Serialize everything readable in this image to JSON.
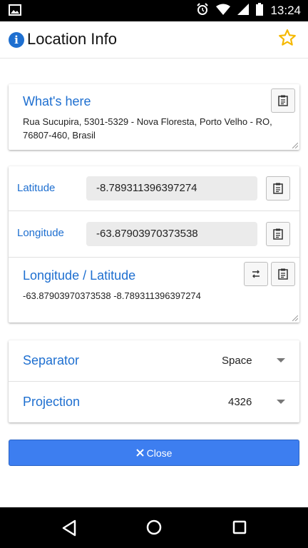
{
  "status_bar": {
    "time": "13:24"
  },
  "app_bar": {
    "title": "Location Info"
  },
  "what_here": {
    "label": "What's here",
    "address": "Rua Sucupira, 5301-5329 - Nova Floresta, Porto Velho - RO, 76807-460, Brasil"
  },
  "coords": {
    "latitude_label": "Latitude",
    "latitude_value": "-8.789311396397274",
    "longitude_label": "Longitude",
    "longitude_value": "-63.87903970373538",
    "lonlat_label": "Longitude / Latitude",
    "lonlat_value": "-63.87903970373538 -8.789311396397274"
  },
  "settings": {
    "separator_label": "Separator",
    "separator_value": "Space",
    "projection_label": "Projection",
    "projection_value": "4326"
  },
  "close_label": "Close",
  "colors": {
    "accent": "#1e6fd0",
    "button": "#3d7ef0",
    "star": "#f5b800"
  }
}
